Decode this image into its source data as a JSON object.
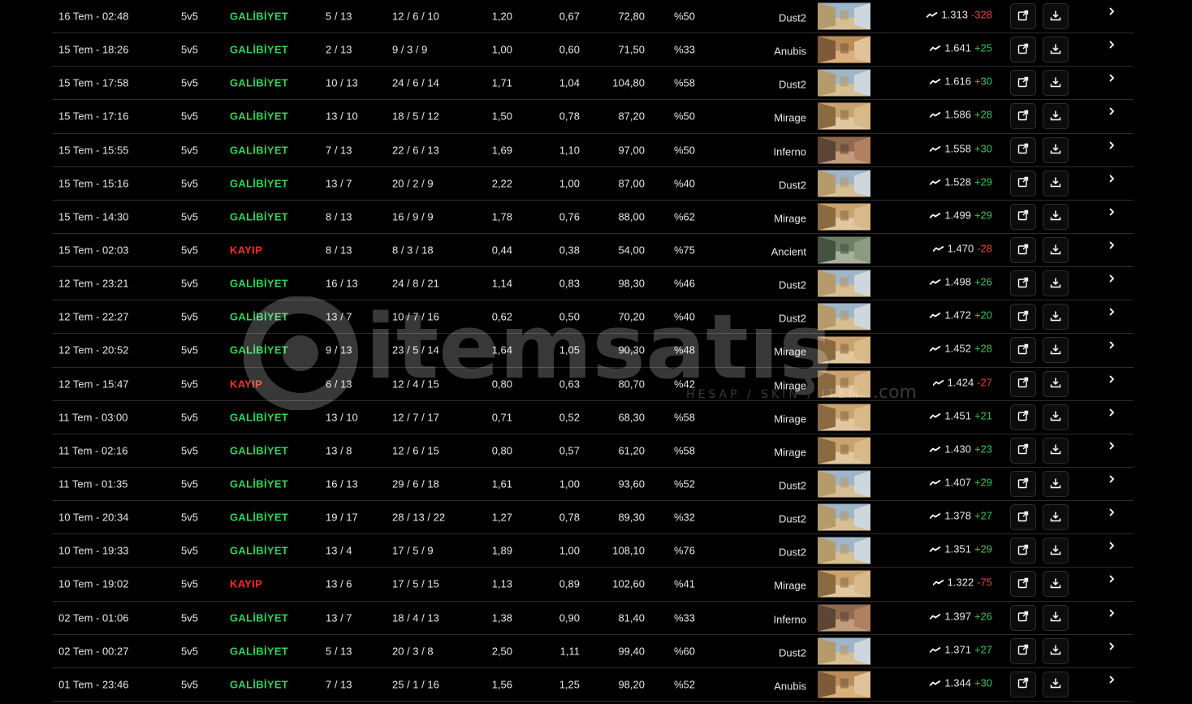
{
  "matches": [
    {
      "date": "16 Tem - 02:48",
      "mode": "5v5",
      "result": "GALİBİYET",
      "win": true,
      "score": "5 / 13",
      "kda": "12 / 6 / 10",
      "kd": "1,20",
      "adr": "0,67",
      "dmg": "72,80",
      "hs": "%50",
      "map": "Dust2",
      "elo": "1.313",
      "change": "-328"
    },
    {
      "date": "15 Tem - 18:26",
      "mode": "5v5",
      "result": "GALİBİYET",
      "win": true,
      "score": "2 / 13",
      "kda": "9 / 3 / 9",
      "kd": "1,00",
      "adr": "0,60",
      "dmg": "71,50",
      "hs": "%33",
      "map": "Anubis",
      "elo": "1.641",
      "change": "+25"
    },
    {
      "date": "15 Tem - 17:58",
      "mode": "5v5",
      "result": "GALİBİYET",
      "win": true,
      "score": "10 / 13",
      "kda": "24 / 6 / 14",
      "kd": "1,71",
      "adr": "1,04",
      "dmg": "104,80",
      "hs": "%58",
      "map": "Dust2",
      "elo": "1.616",
      "change": "+30"
    },
    {
      "date": "15 Tem - 17:16",
      "mode": "5v5",
      "result": "GALİBİYET",
      "win": true,
      "score": "13 / 10",
      "kda": "18 / 5 / 12",
      "kd": "1,50",
      "adr": "0,78",
      "dmg": "87,20",
      "hs": "%50",
      "map": "Mirage",
      "elo": "1.586",
      "change": "+28"
    },
    {
      "date": "15 Tem - 15:55",
      "mode": "5v5",
      "result": "GALİBİYET",
      "win": true,
      "score": "7 / 13",
      "kda": "22 / 6 / 13",
      "kd": "1,69",
      "adr": "1,10",
      "dmg": "97,00",
      "hs": "%50",
      "map": "Inferno",
      "elo": "1.558",
      "change": "+30"
    },
    {
      "date": "15 Tem - 15:16",
      "mode": "5v5",
      "result": "GALİBİYET",
      "win": true,
      "score": "13 / 7",
      "kda": "20 / 2 / 9",
      "kd": "2,22",
      "adr": "1,00",
      "dmg": "87,00",
      "hs": "%40",
      "map": "Dust2",
      "elo": "1.528",
      "change": "+29"
    },
    {
      "date": "15 Tem - 14:30",
      "mode": "5v5",
      "result": "GALİBİYET",
      "win": true,
      "score": "8 / 13",
      "kda": "16 / 9 / 9",
      "kd": "1,78",
      "adr": "0,76",
      "dmg": "88,00",
      "hs": "%62",
      "map": "Mirage",
      "elo": "1.499",
      "change": "+29"
    },
    {
      "date": "15 Tem - 02:03",
      "mode": "5v5",
      "result": "KAYIP",
      "win": false,
      "score": "8 / 13",
      "kda": "8 / 3 / 18",
      "kd": "0,44",
      "adr": "0,38",
      "dmg": "54,00",
      "hs": "%75",
      "map": "Ancient",
      "elo": "1.470",
      "change": "-28"
    },
    {
      "date": "12 Tem - 23:21",
      "mode": "5v5",
      "result": "GALİBİYET",
      "win": true,
      "score": "16 / 13",
      "kda": "24 / 8 / 21",
      "kd": "1,14",
      "adr": "0,83",
      "dmg": "98,30",
      "hs": "%46",
      "map": "Dust2",
      "elo": "1.498",
      "change": "+26"
    },
    {
      "date": "12 Tem - 22:27",
      "mode": "5v5",
      "result": "GALİBİYET",
      "win": true,
      "score": "13 / 7",
      "kda": "10 / 7 / 16",
      "kd": "0,62",
      "adr": "0,50",
      "dmg": "70,20",
      "hs": "%40",
      "map": "Dust2",
      "elo": "1.472",
      "change": "+20"
    },
    {
      "date": "12 Tem - 20:52",
      "mode": "5v5",
      "result": "GALİBİYET",
      "win": true,
      "score": "9 / 13",
      "kda": "23 / 5 / 14",
      "kd": "1,64",
      "adr": "1,05",
      "dmg": "90,30",
      "hs": "%48",
      "map": "Mirage",
      "elo": "1.452",
      "change": "+28"
    },
    {
      "date": "12 Tem - 15:47",
      "mode": "5v5",
      "result": "KAYIP",
      "win": false,
      "score": "6 / 13",
      "kda": "12 / 4 / 15",
      "kd": "0,80",
      "adr": "0,63",
      "dmg": "80,70",
      "hs": "%42",
      "map": "Mirage",
      "elo": "1.424",
      "change": "-27"
    },
    {
      "date": "11 Tem - 03:00",
      "mode": "5v5",
      "result": "GALİBİYET",
      "win": true,
      "score": "13 / 10",
      "kda": "12 / 7 / 17",
      "kd": "0,71",
      "adr": "0,52",
      "dmg": "68,30",
      "hs": "%58",
      "map": "Mirage",
      "elo": "1.451",
      "change": "+21"
    },
    {
      "date": "11 Tem - 02:16",
      "mode": "5v5",
      "result": "GALİBİYET",
      "win": true,
      "score": "13 / 8",
      "kda": "12 / 6 / 15",
      "kd": "0,80",
      "adr": "0,57",
      "dmg": "61,20",
      "hs": "%58",
      "map": "Mirage",
      "elo": "1.430",
      "change": "+23"
    },
    {
      "date": "11 Tem - 01:35",
      "mode": "5v5",
      "result": "GALİBİYET",
      "win": true,
      "score": "16 / 13",
      "kda": "29 / 6 / 18",
      "kd": "1,61",
      "adr": "1,00",
      "dmg": "93,60",
      "hs": "%52",
      "map": "Dust2",
      "elo": "1.407",
      "change": "+29"
    },
    {
      "date": "10 Tem - 20:34",
      "mode": "5v5",
      "result": "GALİBİYET",
      "win": true,
      "score": "19 / 17",
      "kda": "28 / 13 / 22",
      "kd": "1,27",
      "adr": "0,78",
      "dmg": "89,30",
      "hs": "%32",
      "map": "Dust2",
      "elo": "1.378",
      "change": "+27"
    },
    {
      "date": "10 Tem - 19:33",
      "mode": "5v5",
      "result": "GALİBİYET",
      "win": true,
      "score": "13 / 4",
      "kda": "17 / 5 / 9",
      "kd": "1,89",
      "adr": "1,00",
      "dmg": "108,10",
      "hs": "%76",
      "map": "Dust2",
      "elo": "1.351",
      "change": "+29"
    },
    {
      "date": "10 Tem - 19:02",
      "mode": "5v5",
      "result": "KAYIP",
      "win": false,
      "score": "13 / 6",
      "kda": "17 / 5 / 15",
      "kd": "1,13",
      "adr": "0,89",
      "dmg": "102,60",
      "hs": "%41",
      "map": "Mirage",
      "elo": "1.322",
      "change": "-75"
    },
    {
      "date": "02 Tem - 01:06",
      "mode": "5v5",
      "result": "GALİBİYET",
      "win": true,
      "score": "13 / 7",
      "kda": "18 / 4 / 13",
      "kd": "1,38",
      "adr": "0,90",
      "dmg": "81,40",
      "hs": "%33",
      "map": "Inferno",
      "elo": "1.397",
      "change": "+26"
    },
    {
      "date": "02 Tem - 00:27",
      "mode": "5v5",
      "result": "GALİBİYET",
      "win": true,
      "score": "5 / 13",
      "kda": "20 / 3 / 8",
      "kd": "2,50",
      "adr": "1,11",
      "dmg": "99,40",
      "hs": "%60",
      "map": "Dust2",
      "elo": "1.371",
      "change": "+27"
    },
    {
      "date": "01 Tem - 23:46",
      "mode": "5v5",
      "result": "GALİBİYET",
      "win": true,
      "score": "7 / 13",
      "kda": "25 / 1 / 16",
      "kd": "1,56",
      "adr": "1,25",
      "dmg": "98,20",
      "hs": "%52",
      "map": "Anubis",
      "elo": "1.344",
      "change": "+30"
    }
  ],
  "icons": {
    "trend": "trend-up-icon",
    "open": "external-link-icon",
    "download": "download-icon",
    "expand": "chevron-right-icon"
  },
  "colors": {
    "win": "#2fd25a",
    "loss": "#ff2b2b",
    "positive": "#35c759",
    "negative": "#ff3b3b",
    "background": "#000000"
  },
  "watermark": {
    "brand": "itemsatış",
    "tagline": "HESAP / SKIN / ITEM",
    "domain": ".com"
  }
}
